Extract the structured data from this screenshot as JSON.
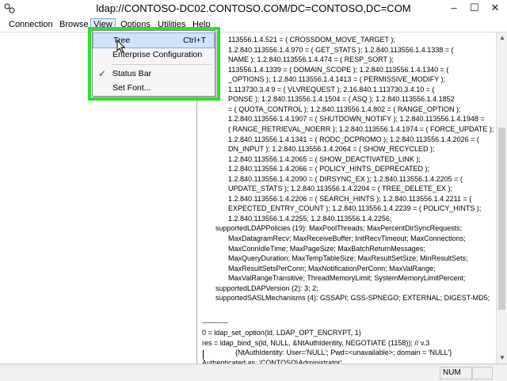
{
  "window": {
    "title": "ldap://CONTOSO-DC02.CONTOSO.COM/DC=CONTOSO,DC=COM",
    "app_icon": "ldp-icon",
    "minimize": "–",
    "maximize": "☐",
    "close": "✕"
  },
  "menu": [
    "Connection",
    "Browse",
    "View",
    "Options",
    "Utilities",
    "Help"
  ],
  "view_menu": {
    "items": [
      {
        "label": "Tree",
        "shortcut": "Ctrl+T",
        "checked": false
      },
      {
        "label": "Enterprise Configuration",
        "shortcut": "",
        "checked": false
      },
      {
        "label": "Status Bar",
        "shortcut": "",
        "checked": true
      },
      {
        "label": "Set Font...",
        "shortcut": "",
        "checked": false
      }
    ],
    "check_mark": "✓"
  },
  "output_lines": [
    "113556.1.4.521 = ( CROSSDOM_MOVE_TARGET );",
    "1.2.840.113556.1.4.970 = ( GET_STATS ); 1.2.840.113556.1.4.1338 = (",
    "NAME ); 1.2.840.113556.1.4.474 = ( RESP_SORT );",
    "113556.1.4.1339 = ( DOMAIN_SCOPE ); 1.2.840.113556.1.4.1340 = (",
    "_OPTIONS ); 1.2.840.113556.1.4.1413 = ( PERMISSIVE_MODIFY );",
    "1.113730.3.4.9 = ( VLVREQUEST ); 2.16.840.1.113730.3.4.10 = (",
    "PONSE ); 1.2.840.113556.1.4.1504 = ( ASQ ); 1.2.840.113556.1.4.1852",
    "= ( QUOTA_CONTROL ); 1.2.840.113556.1.4.802 = ( RANGE_OPTION );",
    "1.2.840.113556.1.4.1907 = ( SHUTDOWN_NOTIFY ); 1.2.840.113556.1.4.1948 =",
    "( RANGE_RETRIEVAL_NOERR ); 1.2.840.113556.1.4.1974 = ( FORCE_UPDATE );",
    "1.2.840.113556.1.4.1341 = ( RODC_DCPROMO ); 1.2.840.113556.1.4.2026 = (",
    "DN_INPUT ); 1.2.840.113556.1.4.2064 = ( SHOW_RECYCLED );",
    "1.2.840.113556.1.4.2065 = ( SHOW_DEACTIVATED_LINK );",
    "1.2.840.113556.1.4.2066 = ( POLICY_HINTS_DEPRECATED );",
    "1.2.840.113556.1.4.2090 = ( DIRSYNC_EX ); 1.2.840.113556.1.4.2205 = (",
    "UPDATE_STATS ); 1.2.840.113556.1.4.2204 = ( TREE_DELETE_EX );",
    "1.2.840.113556.1.4.2206 = ( SEARCH_HINTS ); 1.2.840.113556.1.4.2211 = (",
    "EXPECTED_ENTRY_COUNT ); 1.2.840.113556.1.4.2239 = ( POLICY_HINTS );",
    "1.2.840.113556.1.4.2255; 1.2.840.113556.1.4.2256;",
    "supportedLDAPPolicies (19): MaxPoolThreads; MaxPercentDirSyncRequests;",
    "MaxDatagramRecv; MaxReceiveBuffer; InitRecvTimeout; MaxConnections;",
    "MaxConnIdleTime; MaxPageSize; MaxBatchReturnMessages;",
    "MaxQueryDuration; MaxTempTableSize; MaxResultSetSize; MinResultSets;",
    "MaxResultSetsPerConn; MaxNotificationPerConn; MaxValRange;",
    "MaxValRangeTransitive; ThreadMemoryLimit; SystemMemoryLimitPercent;",
    "supportedLDAPVersion (2): 3; 2;",
    "supportedSASLMechanisms (4): GSSAPI; GSS-SPNEGO; EXTERNAL; DIGEST-MD5;",
    "",
    "-----------",
    "0 = ldap_set_option(ld, LDAP_OPT_ENCRYPT, 1)",
    "res = ldap_bind_s(ld, NULL, &NtAuthIdentity, NEGOTIATE (1158)); // v.3",
    "{NtAuthIdentity: User='NULL'; Pwd=<unavailable>; domain = 'NULL'}",
    "Authenticated as: 'CONTOSO\\Administrator'.",
    "-----------"
  ],
  "status": {
    "num": "NUM"
  },
  "highlight_color": "#2de02d"
}
